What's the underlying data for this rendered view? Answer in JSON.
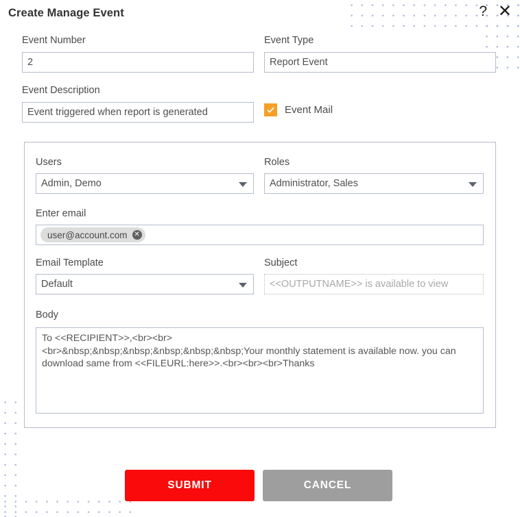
{
  "dialog": {
    "title": "Create Manage Event",
    "help_icon": "question-mark",
    "close_icon": "close-x"
  },
  "form": {
    "event_number": {
      "label": "Event Number",
      "value": "2"
    },
    "event_type": {
      "label": "Event Type",
      "value": "Report Event"
    },
    "event_description": {
      "label": "Event Description",
      "value": "Event triggered when report is generated"
    },
    "event_mail": {
      "label": "Event Mail",
      "checked": true,
      "check_color": "#f5a025"
    }
  },
  "mail_panel": {
    "users": {
      "label": "Users",
      "value": "Admin, Demo"
    },
    "roles": {
      "label": "Roles",
      "value": "Administrator, Sales"
    },
    "email": {
      "label": "Enter email",
      "chips": [
        {
          "text": "user@account.com",
          "remove_icon": "close-circle-icon"
        }
      ]
    },
    "email_template": {
      "label": "Email Template",
      "value": "Default"
    },
    "subject": {
      "label": "Subject",
      "value": "<<OUTPUTNAME>> is available to view"
    },
    "body": {
      "label": "Body",
      "value": "To <<RECIPIENT>>,<br><br>\n<br>&nbsp;&nbsp;&nbsp;&nbsp;&nbsp;&nbsp;Your monthly statement is available now. you can download same from <<FILEURL:here>>.<br><br><br>Thanks"
    }
  },
  "footer": {
    "submit_label": "SUBMIT",
    "cancel_label": "CANCEL",
    "submit_color": "#fa0a0a",
    "cancel_color": "#9e9e9e"
  }
}
